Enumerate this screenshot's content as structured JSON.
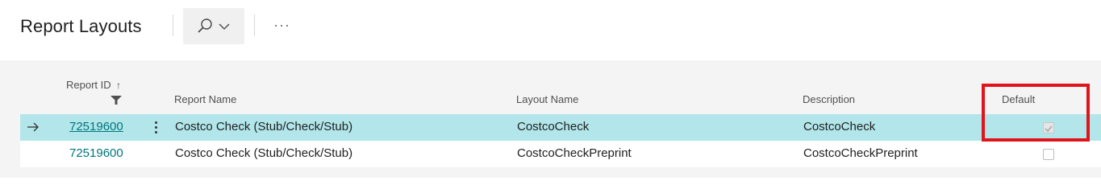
{
  "header": {
    "title": "Report Layouts",
    "search_icon": "search-icon",
    "search_chevron": "chevron-down-icon",
    "more_icon": "more-icon"
  },
  "table": {
    "columns": {
      "report_id": "Report ID",
      "report_id_sort": "↑",
      "report_name": "Report Name",
      "layout_name": "Layout Name",
      "description": "Description",
      "default": "Default"
    },
    "rows": [
      {
        "selected": true,
        "report_id": "72519600",
        "report_name": "Costco Check (Stub/Check/Stub)",
        "layout_name": "CostcoCheck",
        "description": "CostcoCheck",
        "default": true
      },
      {
        "selected": false,
        "report_id": "72519600",
        "report_name": "Costco Check (Stub/Check/Stub)",
        "layout_name": "CostcoCheckPreprint",
        "description": "CostcoCheckPreprint",
        "default": false
      }
    ]
  },
  "colors": {
    "selected_row": "#b2e6ea",
    "link": "#00767a",
    "highlight": "#e0141b"
  }
}
